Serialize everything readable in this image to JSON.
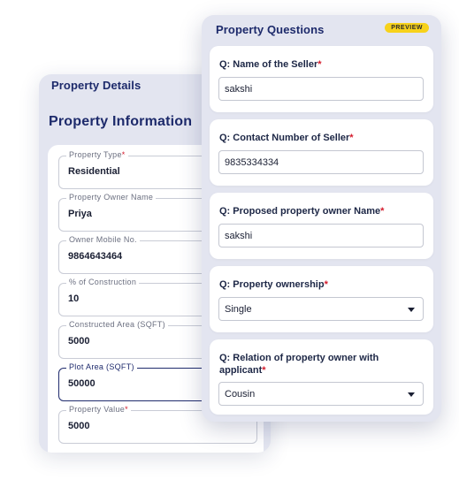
{
  "property_details": {
    "header": "Property Details",
    "title": "Property Information",
    "fields": [
      {
        "label": "Property Type",
        "required": "*",
        "value": "Residential"
      },
      {
        "label": "Property Owner Name",
        "required": "",
        "value": "Priya"
      },
      {
        "label": "Owner Mobile No.",
        "required": "",
        "value": "9864643464"
      },
      {
        "label": "% of Construction",
        "required": "",
        "value": "10"
      },
      {
        "label": "Constructed Area (SQFT)",
        "required": "",
        "value": "5000"
      },
      {
        "label": "Plot Area (SQFT)",
        "required": "",
        "value": "50000"
      },
      {
        "label": "Property Value",
        "required": "*",
        "value": "5000"
      }
    ]
  },
  "property_questions": {
    "header": "Property Questions",
    "badge": "PREVIEW",
    "questions": [
      {
        "text": "Q: Name of the Seller",
        "required": "*",
        "value": "sakshi",
        "type": "text"
      },
      {
        "text": "Q: Contact Number of Seller",
        "required": "*",
        "value": "9835334334",
        "type": "text"
      },
      {
        "text": "Q: Proposed property owner Name",
        "required": "*",
        "value": "sakshi",
        "type": "text"
      },
      {
        "text": "Q: Property ownership",
        "required": "*",
        "value": "Single",
        "type": "select"
      },
      {
        "text": "Q: Relation of property owner with applicant",
        "required": "*",
        "value": "Cousin",
        "type": "select"
      }
    ]
  },
  "colors": {
    "panel_bg": "#e3e5f0",
    "heading": "#1d2a6b",
    "required": "#d41b2c",
    "badge_bg": "#f7d21b",
    "focus_border": "#1f2b6d"
  }
}
